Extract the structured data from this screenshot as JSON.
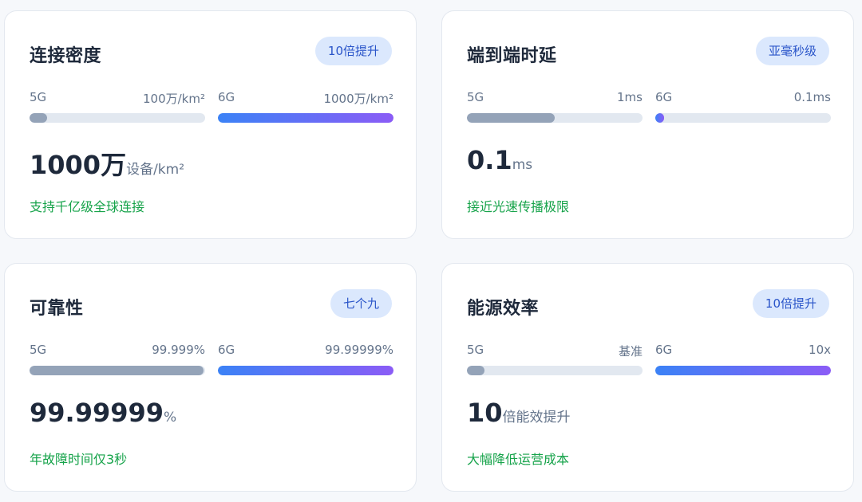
{
  "colors": {
    "accent_gradient_start": "#3b82f6",
    "accent_gradient_end": "#8b5cf6",
    "fill_5g": "#94a3b8",
    "track": "#e2e8f0",
    "badge_bg": "#dbe8fd",
    "badge_text": "#2a55c9",
    "note_green": "#16a34a"
  },
  "cards": [
    {
      "title": "连接密度",
      "badge": "10倍提升",
      "g5": {
        "label": "5G",
        "value": "100万/km²",
        "fill_fraction": 0.1
      },
      "g6": {
        "label": "6G",
        "value": "1000万/km²",
        "fill_fraction": 1.0
      },
      "big_value": "1000万",
      "big_unit": "设备/km²",
      "note": "支持千亿级全球连接"
    },
    {
      "title": "端到端时延",
      "badge": "亚毫秒级",
      "g5": {
        "label": "5G",
        "value": "1ms",
        "fill_fraction": 0.5
      },
      "g6": {
        "label": "6G",
        "value": "0.1ms",
        "fill_fraction": 0.05
      },
      "big_value": "0.1",
      "big_unit": "ms",
      "note": "接近光速传播极限"
    },
    {
      "title": "可靠性",
      "badge": "七个九",
      "g5": {
        "label": "5G",
        "value": "99.999%",
        "fill_fraction": 0.99
      },
      "g6": {
        "label": "6G",
        "value": "99.99999%",
        "fill_fraction": 1.0
      },
      "big_value": "99.99999",
      "big_unit": "%",
      "note": "年故障时间仅3秒"
    },
    {
      "title": "能源效率",
      "badge": "10倍提升",
      "g5": {
        "label": "5G",
        "value": "基准",
        "fill_fraction": 0.1
      },
      "g6": {
        "label": "6G",
        "value": "10x",
        "fill_fraction": 1.0
      },
      "big_value": "10",
      "big_unit": "倍能效提升",
      "note": "大幅降低运营成本"
    }
  ]
}
